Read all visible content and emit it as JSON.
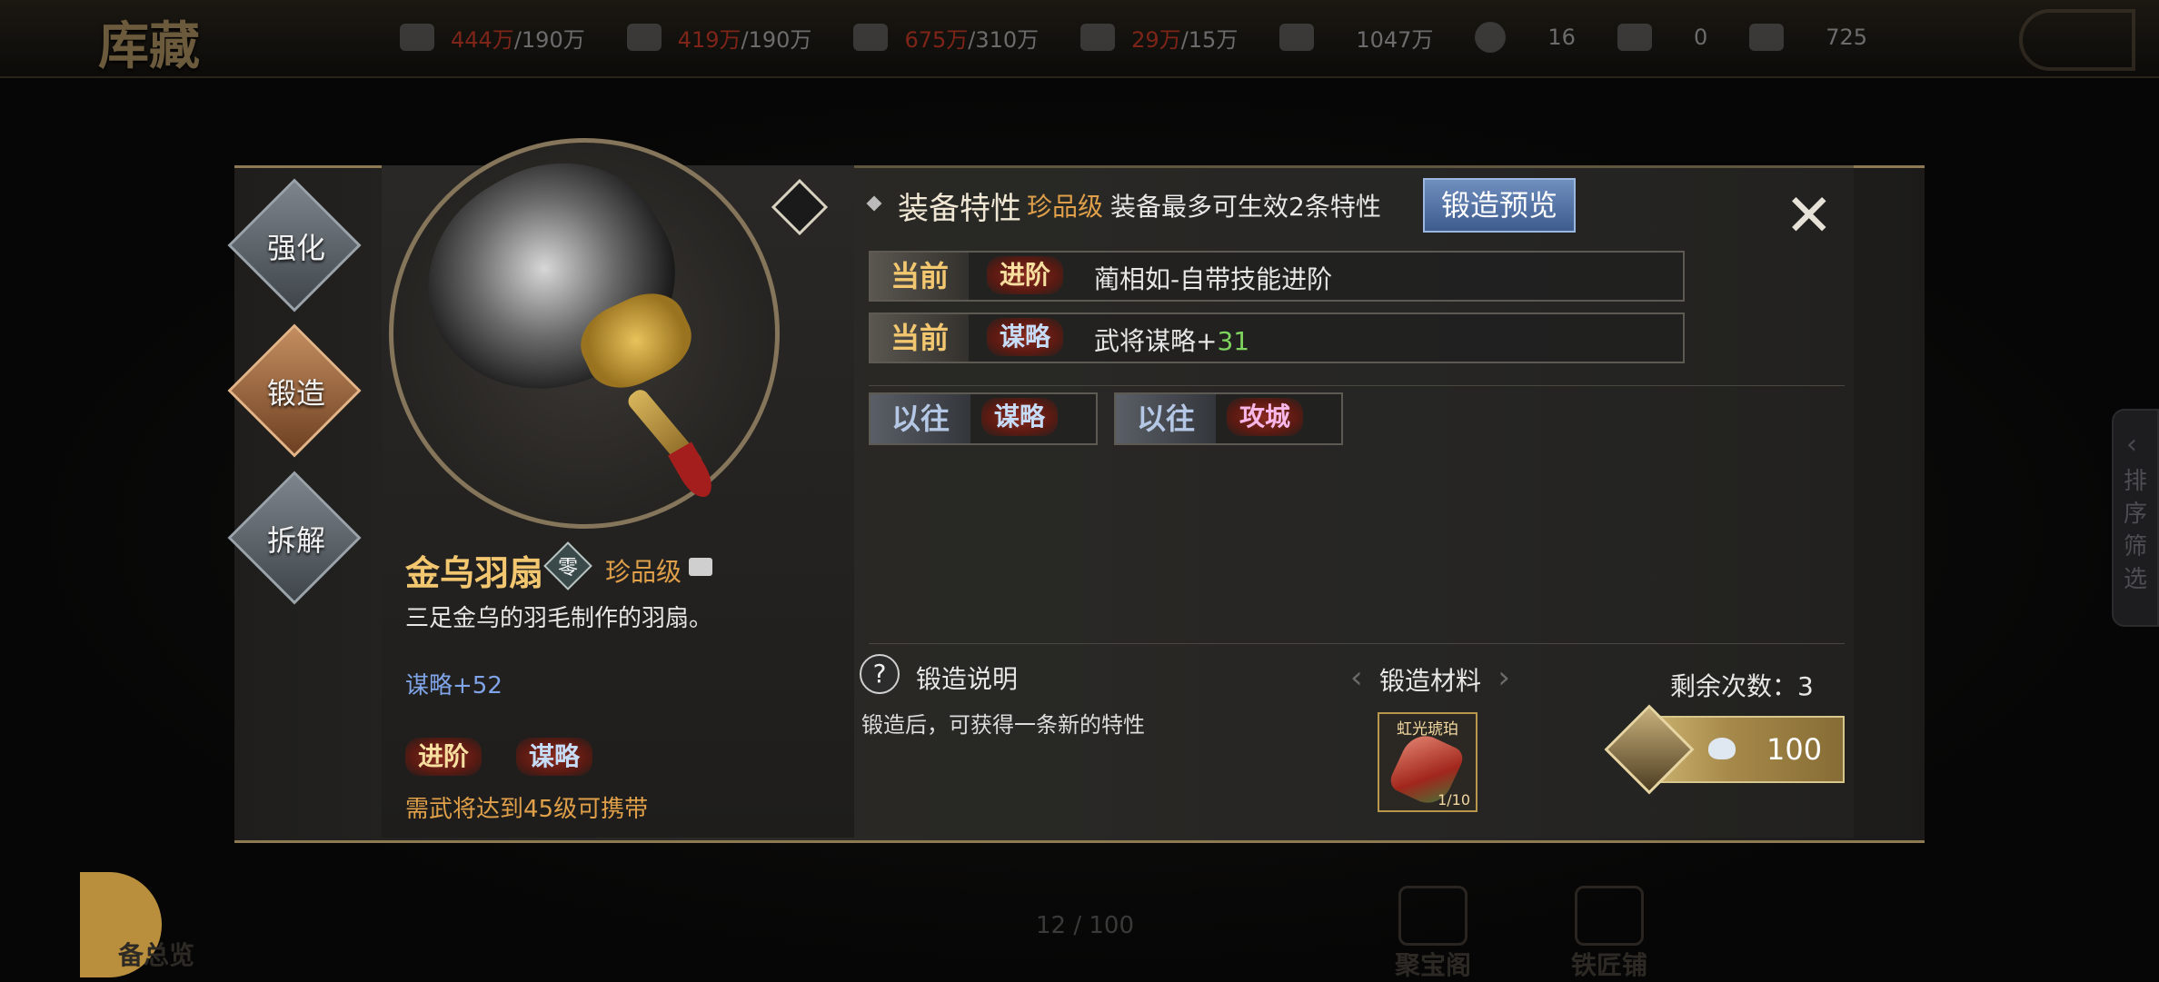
{
  "topbar": {
    "title": "库藏",
    "resources": [
      {
        "icon": "grain-icon",
        "current": "444万",
        "max": "/190万"
      },
      {
        "icon": "wood-icon",
        "current": "419万",
        "max": "/190万"
      },
      {
        "icon": "stone-icon",
        "current": "675万",
        "max": "/310万"
      },
      {
        "icon": "iron-icon",
        "current": "29万",
        "max": "/15万"
      },
      {
        "icon": "copper-icon",
        "value": "1047万"
      },
      {
        "icon": "coin-icon",
        "value": "16"
      },
      {
        "icon": "gold-ingot-icon",
        "value": "0"
      },
      {
        "icon": "jade-icon",
        "value": "725"
      }
    ]
  },
  "side_tab": {
    "label": "排序筛选"
  },
  "bottom": {
    "left_label": "备总览",
    "page": "12 / 100",
    "btn1": "聚宝阁",
    "btn2": "铁匠铺"
  },
  "tabs": {
    "strengthen": "强化",
    "forge": "锻造",
    "dismantle": "拆解"
  },
  "item": {
    "name": "金乌羽扇",
    "tier": "零",
    "rarity": "珍品级",
    "description": "三足金乌的羽毛制作的羽扇。",
    "stat": "谋略+52",
    "tag1": "进阶",
    "tag2": "谋略",
    "requirement": "需武将达到45级可携带"
  },
  "features": {
    "title": "装备特性",
    "rarity": "珍品级",
    "note": "装备最多可生效2条特性",
    "preview_button": "锻造预览",
    "close": "✕",
    "current_rows": [
      {
        "label": "当前",
        "tag": "进阶",
        "text": "蔺相如-自带技能进阶"
      },
      {
        "label": "当前",
        "tag": "谋略",
        "text_prefix": "武将谋略+",
        "value": "31"
      }
    ],
    "past": [
      {
        "label": "以往",
        "tag": "谋略"
      },
      {
        "label": "以往",
        "tag": "攻城"
      }
    ]
  },
  "forge_info": {
    "help_icon": "?",
    "title": "锻造说明",
    "description": "锻造后，可获得一条新的特性"
  },
  "materials": {
    "title": "锻造材料",
    "item_name": "虹光琥珀",
    "count": "1/10"
  },
  "forge": {
    "remaining": "剩余次数：3",
    "cost": "100"
  },
  "colors": {
    "accent_gold": "#f2c770",
    "rarity_orange": "#e0a04a",
    "stat_blue": "#7fa4e8",
    "value_green": "#7fd35f"
  }
}
